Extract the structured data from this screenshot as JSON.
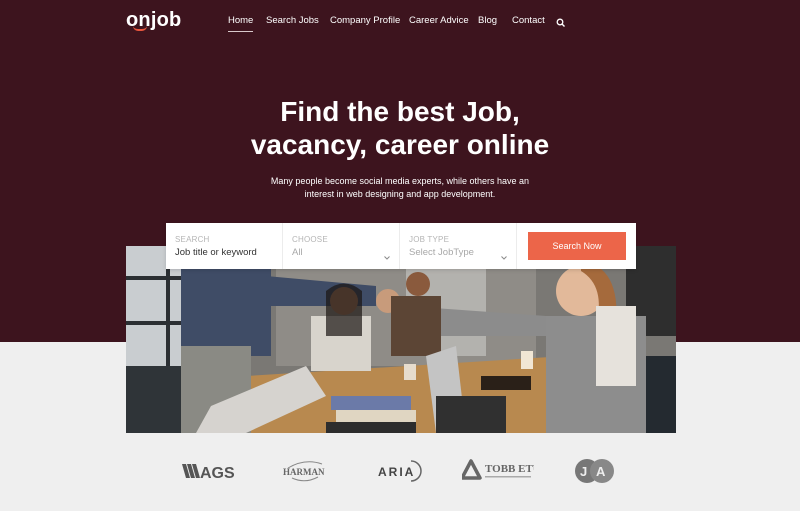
{
  "header": {
    "logo": {
      "part1": "on",
      "part2": "j",
      "part3": "ob"
    },
    "nav": [
      {
        "label": "Home",
        "active": true
      },
      {
        "label": "Search Jobs",
        "active": false
      },
      {
        "label": "Company Profile",
        "active": false
      },
      {
        "label": "Career Advice",
        "active": false
      },
      {
        "label": "Blog",
        "active": false
      },
      {
        "label": "Contact",
        "active": false
      }
    ],
    "search_icon": "search-icon"
  },
  "hero": {
    "title_line1": "Find the best Job,",
    "title_line2": "vacancy, career online",
    "subtitle_line1": "Many people become social media experts, while others have an",
    "subtitle_line2": "interest in web designing and app development."
  },
  "search": {
    "keyword": {
      "label": "SEARCH",
      "value": "Job title or keyword"
    },
    "category": {
      "label": "CHOOSE",
      "value": "All"
    },
    "job_type": {
      "label": "JOB TYPE",
      "value": "Select JobType"
    },
    "button_label": "Search Now"
  },
  "partners": [
    {
      "name": "AGS"
    },
    {
      "name": "HARMAN"
    },
    {
      "name": "ARIA"
    },
    {
      "name": "TOBB ETÜ"
    },
    {
      "name": "JA"
    }
  ],
  "colors": {
    "hero_bg": "#3d141e",
    "accent": "#ec6549",
    "page_bg": "#efefef"
  }
}
